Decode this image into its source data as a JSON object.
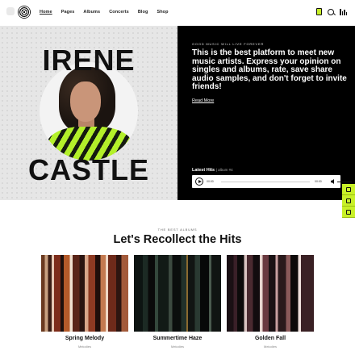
{
  "header": {
    "nav": [
      "Home",
      "Pages",
      "Albums",
      "Concerts",
      "Blog",
      "Shop"
    ],
    "active_nav": "Home"
  },
  "hero": {
    "name_line1": "IRENE",
    "name_line2": "CASTLE",
    "eyebrow": "GOOD MUSIC WILL LIVE FOREVER",
    "headline": "This is the best platform to meet new music artists. Express your opinion on singles and albums, rate, save share audio samples, and don't forget to invite friends!",
    "read_more": "Read More",
    "player": {
      "label": "Latest Hits",
      "sublabel": "| album #4",
      "time_current": "00:00",
      "time_total": "00:00"
    }
  },
  "section": {
    "eyebrow": "THE BEST ALBUMS",
    "title": "Let's Recollect the Hits"
  },
  "albums": [
    {
      "title": "Spring Melody",
      "subtitle": "Melodies"
    },
    {
      "title": "Summertime Haze",
      "subtitle": "Melodies"
    },
    {
      "title": "Golden Fall",
      "subtitle": "Melodies"
    }
  ],
  "colors": {
    "accent": "#c8f028",
    "dark": "#000000",
    "light_bg": "#e6e6e6"
  }
}
